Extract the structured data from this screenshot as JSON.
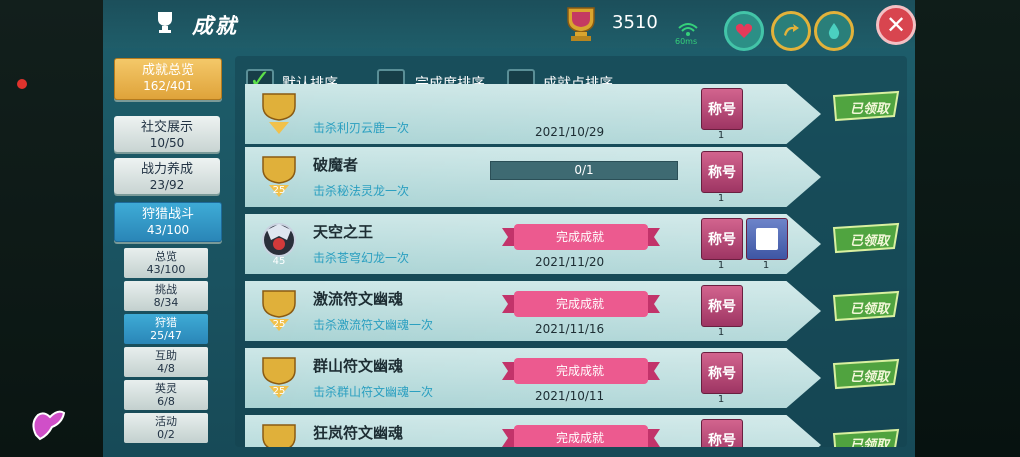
{
  "header": {
    "title": "成就",
    "score": "3510",
    "ping": "60ms"
  },
  "sidebar": {
    "overview": {
      "label": "成就总览",
      "progress": "162/401"
    },
    "items": [
      {
        "label": "社交展示",
        "progress": "10/50"
      },
      {
        "label": "战力养成",
        "progress": "23/92"
      },
      {
        "label": "狩猎战斗",
        "progress": "43/100"
      }
    ],
    "sub_items": [
      {
        "label": "总览",
        "progress": "43/100"
      },
      {
        "label": "挑战",
        "progress": "8/34"
      },
      {
        "label": "狩猎",
        "progress": "25/47"
      },
      {
        "label": "互助",
        "progress": "4/8"
      },
      {
        "label": "英灵",
        "progress": "6/8"
      },
      {
        "label": "活动",
        "progress": "0/2"
      }
    ]
  },
  "sort": {
    "default": "默认排序",
    "completion": "完成度排序",
    "points": "成就点排序"
  },
  "rows": [
    {
      "name": "",
      "desc": "击杀利刃云鹿一次",
      "status": "",
      "date": "2021/10/29",
      "points": "25",
      "reward_label": "称号",
      "reward_count": "1",
      "claimed": "已领取"
    },
    {
      "name": "破魔者",
      "desc": "击杀秘法灵龙一次",
      "status": "",
      "progress": "0/1",
      "date": "",
      "points": "25",
      "reward_label": "称号",
      "reward_count": "1",
      "claimed": ""
    },
    {
      "name": "天空之王",
      "desc": "击杀苍穹幻龙一次",
      "status": "完成成就",
      "date": "2021/11/20",
      "points": "45",
      "reward_label": "称号",
      "reward_count": "1",
      "reward2_count": "1",
      "claimed": "已领取"
    },
    {
      "name": "激流符文幽魂",
      "desc": "击杀激流符文幽魂一次",
      "status": "完成成就",
      "date": "2021/11/16",
      "points": "25",
      "reward_label": "称号",
      "reward_count": "1",
      "claimed": "已领取"
    },
    {
      "name": "群山符文幽魂",
      "desc": "击杀群山符文幽魂一次",
      "status": "完成成就",
      "date": "2021/10/11",
      "points": "25",
      "reward_label": "称号",
      "reward_count": "1",
      "claimed": "已领取"
    },
    {
      "name": "狂岚符文幽魂",
      "desc": "",
      "status": "完成成就",
      "date": "",
      "points": "",
      "reward_label": "称号",
      "reward_count": "",
      "claimed": "已领取"
    }
  ],
  "colors": {
    "accent_gold": "#f4c869",
    "active_blue": "#3eabd6",
    "ribbon_pink": "#e8457e",
    "close_red": "#d8454f"
  }
}
